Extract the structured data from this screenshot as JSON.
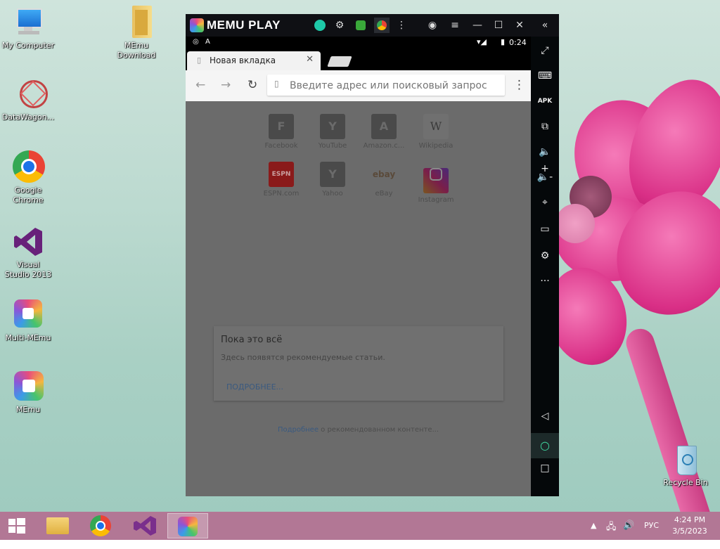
{
  "desktop": {
    "icons": [
      {
        "label": "My Computer"
      },
      {
        "label": "MEmu Download"
      },
      {
        "label": "DataWagon..."
      },
      {
        "label": "Google Chrome"
      },
      {
        "label": "Visual Studio 2013"
      },
      {
        "label": "Multi-MEmu"
      },
      {
        "label": "MEmu"
      },
      {
        "label": "Recycle Bin"
      }
    ]
  },
  "emulator": {
    "title": "MEMU PLAY",
    "status_time": "0:24",
    "sidebar_icons": [
      "fullscreen-icon",
      "keyboard-icon",
      "apk-icon",
      "screenshot-icon",
      "volume-up-icon",
      "volume-down-icon",
      "location-icon",
      "folder-icon",
      "settings-icon",
      "more-icon",
      "back-icon",
      "home-icon",
      "recents-icon"
    ]
  },
  "browser": {
    "tab_title": "Новая вкладка",
    "omnibox_placeholder": "Введите адрес или поисковый запрос",
    "tiles": [
      {
        "letter": "F",
        "label": "Facebook"
      },
      {
        "letter": "Y",
        "label": "YouTube"
      },
      {
        "letter": "A",
        "label": "Amazon.c..."
      },
      {
        "letter": "W",
        "label": "Wikipedia"
      },
      {
        "letter": "ESPN",
        "label": "ESPN.com"
      },
      {
        "letter": "Y",
        "label": "Yahoo"
      },
      {
        "letter": "ebay",
        "label": "eBay"
      },
      {
        "letter": "",
        "label": "Instagram"
      }
    ],
    "card": {
      "title": "Пока это всё",
      "body": "Здесь появятся рекомендуемые статьи.",
      "link": "ПОДРОБНЕЕ..."
    },
    "footer_link": "Подробнее",
    "footer_text": "о рекомендованном контенте..."
  },
  "taskbar": {
    "lang": "РУС",
    "time": "4:24 PM",
    "date": "3/5/2023"
  },
  "colors": {
    "taskbar": "#b27795",
    "accent_link": "#4c7fb8"
  }
}
